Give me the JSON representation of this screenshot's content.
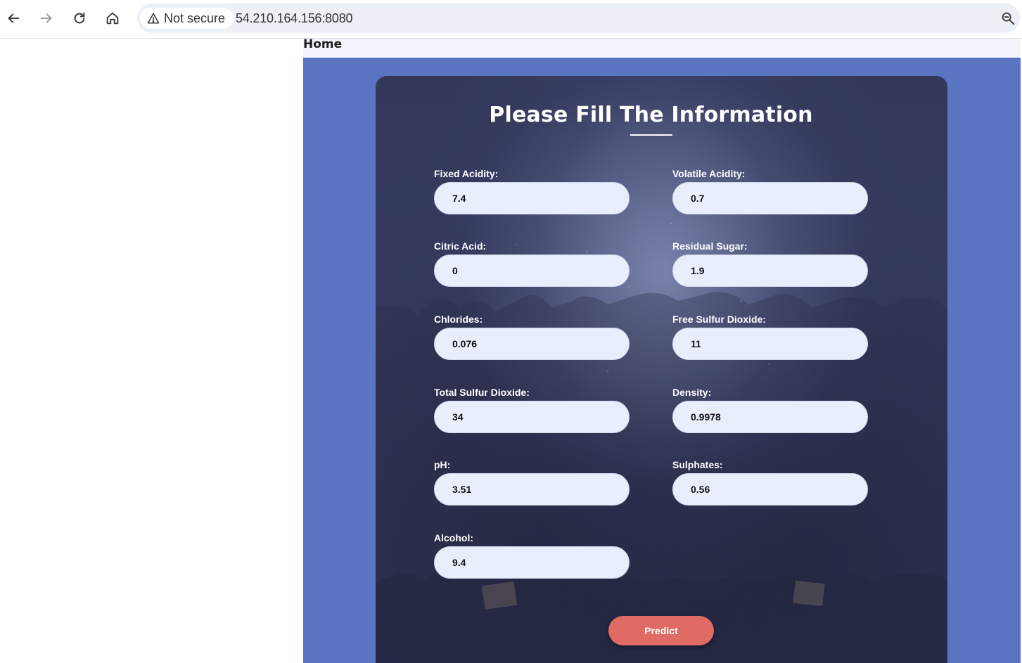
{
  "browser": {
    "security_label": "Not secure",
    "url": "54.210.164.156:8080",
    "icons": [
      "back-arrow-icon",
      "forward-arrow-icon",
      "reload-icon",
      "home-icon",
      "warning-triangle-icon",
      "zoom-icon"
    ]
  },
  "nav": {
    "home_label": "Home"
  },
  "form": {
    "title": "Please Fill The Information",
    "fields": [
      {
        "label": "Fixed Acidity:",
        "value": "7.4"
      },
      {
        "label": "Volatile Acidity:",
        "value": "0.7"
      },
      {
        "label": "Citric Acid:",
        "value": "0"
      },
      {
        "label": "Residual Sugar:",
        "value": "1.9"
      },
      {
        "label": "Chlorides:",
        "value": "0.076"
      },
      {
        "label": "Free Sulfur Dioxide:",
        "value": "11"
      },
      {
        "label": "Total Sulfur Dioxide:",
        "value": "34"
      },
      {
        "label": "Density:",
        "value": "0.9978"
      },
      {
        "label": "pH:",
        "value": "3.51"
      },
      {
        "label": "Sulphates:",
        "value": "0.56"
      },
      {
        "label": "Alcohol:",
        "value": "9.4"
      }
    ],
    "submit_label": "Predict"
  },
  "colors": {
    "page_background": "#5975c2",
    "card_background": "#353a5c",
    "input_background": "#e8eefb",
    "button_background": "#e06a64"
  }
}
